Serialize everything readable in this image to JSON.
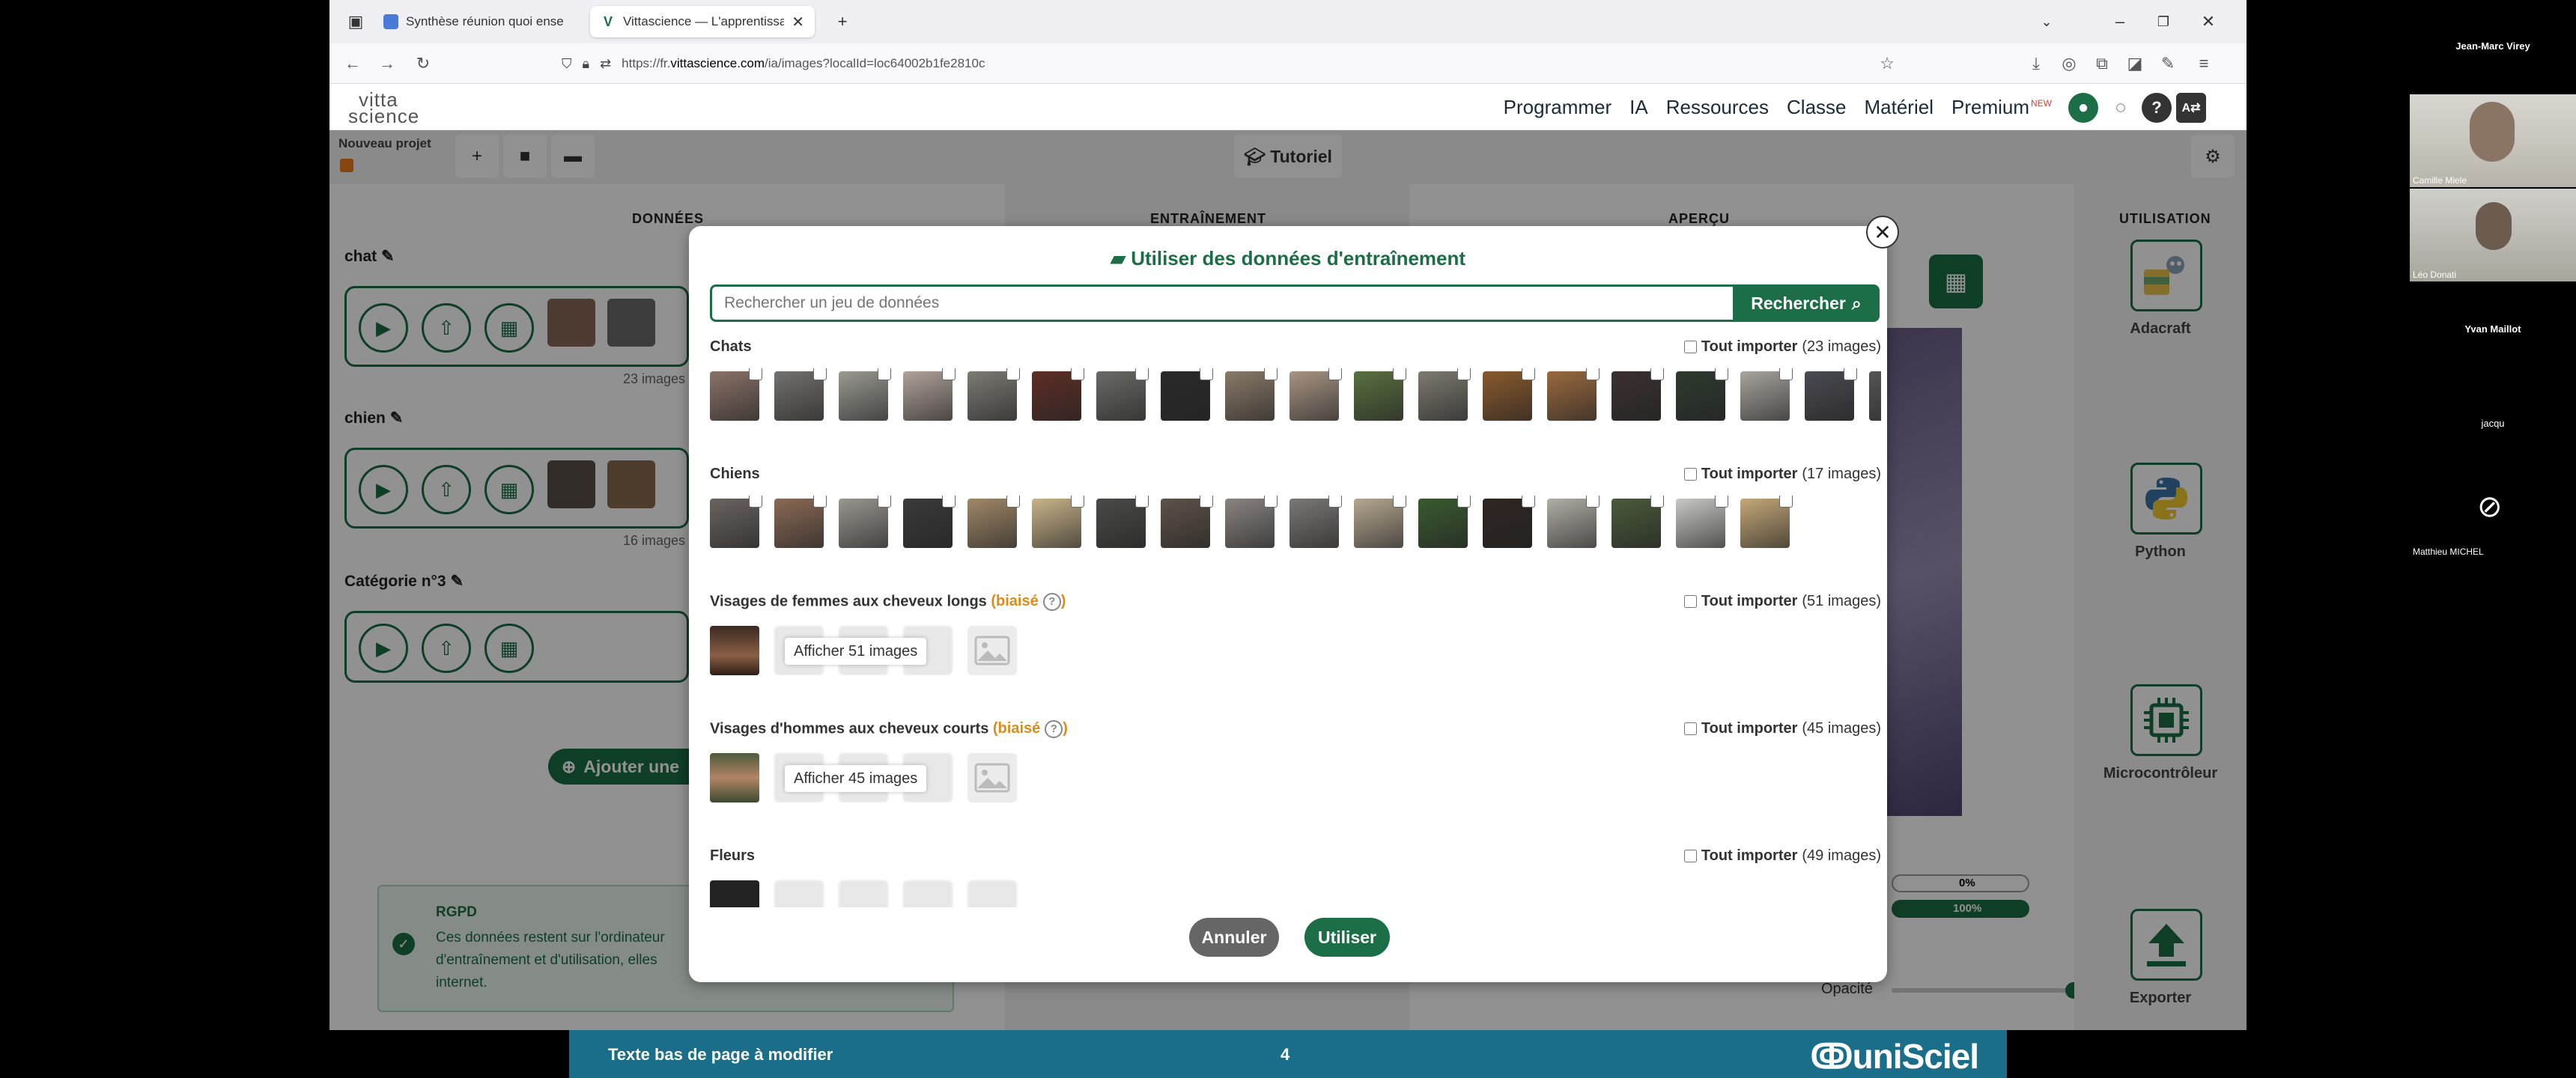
{
  "browser": {
    "tabs": [
      {
        "label": "Synthèse réunion quoi enseigner",
        "active": false
      },
      {
        "label": "Vittascience — L'apprentissage",
        "active": true
      }
    ],
    "url_prefix": "https://fr.",
    "url_domain": "vittascience.com",
    "url_path": "/ia/images?localId=loc64002b1fe2810c"
  },
  "site": {
    "logo_line1": "vitta",
    "logo_line2": "science",
    "nav": [
      "Programmer",
      "IA",
      "Ressources",
      "Classe",
      "Matériel",
      "Premium"
    ],
    "premium_badge": "NEW"
  },
  "toolbar": {
    "project_name": "Nouveau projet",
    "tutorial_label": "Tutoriel"
  },
  "columns": {
    "data": "DONNÉES",
    "training": "ENTRAÎNEMENT",
    "preview": "APERÇU",
    "usage": "UTILISATION"
  },
  "categories": [
    {
      "name": "chat",
      "count": "23 images"
    },
    {
      "name": "chien",
      "count": "16 images"
    },
    {
      "name": "Catégorie n°3",
      "count": ""
    }
  ],
  "add_category_label": "Ajouter une",
  "rgpd": {
    "title": "RGPD",
    "line1": "Ces données restent sur l'ordinateur",
    "line2": "d'entraînement et d'utilisation, elles",
    "line3": "internet."
  },
  "preview": {
    "pct1": "0%",
    "pct2": "100%",
    "opacity_label": "Opacité",
    "opacity_value": 50
  },
  "usage_items": [
    {
      "label": "Adacraft"
    },
    {
      "label": "Python"
    },
    {
      "label": "Microcontrôleur"
    },
    {
      "label": "Exporter"
    }
  ],
  "modal": {
    "title": "Utiliser des données d'entraînement",
    "search_placeholder": "Rechercher un jeu de données",
    "search_button": "Rechercher",
    "import_all": "Tout importer",
    "biased": "(biaisé",
    "biased_close": ")",
    "datasets": [
      {
        "name": "Chats",
        "count": "(23 images)",
        "biased": false,
        "show_more": ""
      },
      {
        "name": "Chiens",
        "count": "(17 images)",
        "biased": false,
        "show_more": ""
      },
      {
        "name": "Visages de femmes aux cheveux longs",
        "count": "(51 images)",
        "biased": true,
        "show_more": "Afficher 51 images"
      },
      {
        "name": "Visages d'hommes aux cheveux courts",
        "count": "(45 images)",
        "biased": true,
        "show_more": "Afficher 45 images"
      },
      {
        "name": "Fleurs",
        "count": "(49 images)",
        "biased": false,
        "show_more": ""
      }
    ],
    "cancel": "Annuler",
    "use": "Utiliser"
  },
  "footer": {
    "left": "Texte bas de page à modifier",
    "page_number": "4",
    "brand": "uniSciel"
  },
  "participants": [
    {
      "name": "Jean-Marc Virey",
      "video": false
    },
    {
      "name": "Camille Miele",
      "video": true
    },
    {
      "name": "Léo Donati",
      "video": true
    },
    {
      "name": "Yvan Maillot",
      "video": false
    },
    {
      "name": "jacqu",
      "video": false
    },
    {
      "name": "Matthieu MICHEL",
      "video": false
    }
  ],
  "colors": {
    "green": "#1b6e46",
    "orange": "#e08a17",
    "footer_blue": "#1b6e8a"
  }
}
